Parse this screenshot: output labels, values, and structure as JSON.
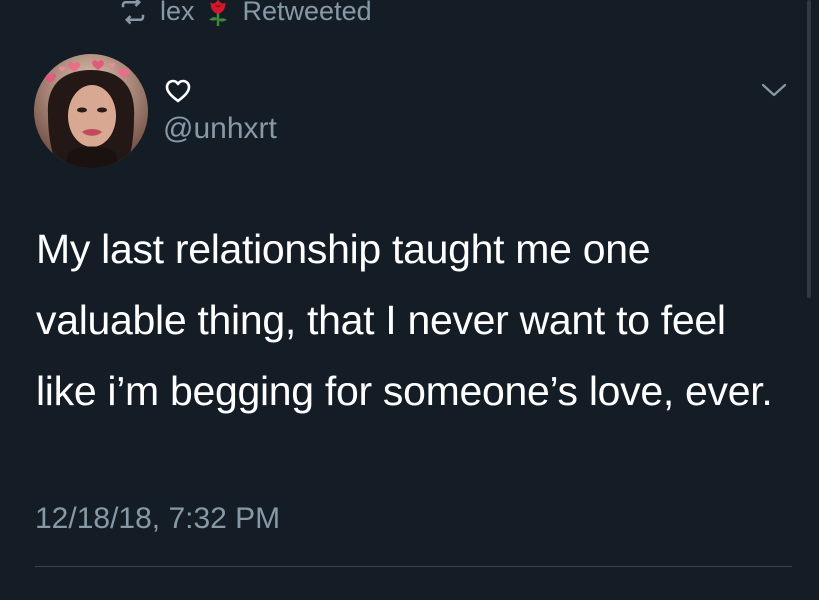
{
  "retweet_bar": {
    "icon": "retweet-icon",
    "name": "lex",
    "emoji": "rose-icon",
    "label": "Retweeted"
  },
  "author": {
    "badge_icon": "heart-outline-icon",
    "handle": "@unhxrt"
  },
  "tweet": {
    "text": "My last relationship taught me one valuable thing, that I never want to feel like i’m begging for someone’s love, ever.",
    "timestamp": "12/18/18, 7:32 PM"
  },
  "menu": {
    "icon": "chevron-down-icon"
  },
  "colors": {
    "background": "#141d26",
    "text": "#ffffff",
    "secondary": "#8899a6",
    "divider": "#38444d"
  }
}
